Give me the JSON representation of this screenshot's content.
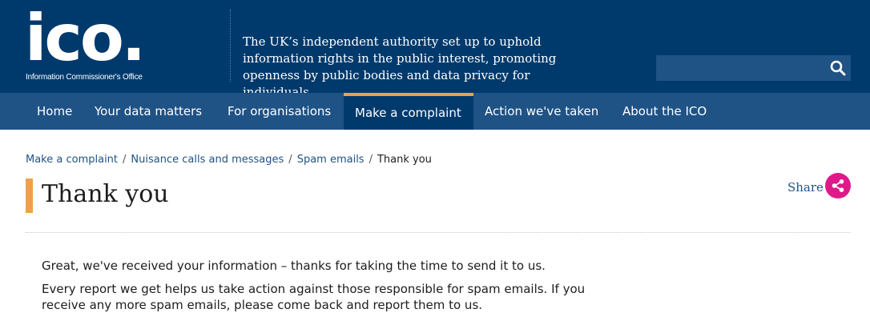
{
  "header": {
    "logo_text": "ico.",
    "logo_subtitle": "Information Commissioner's Office",
    "tagline": "The UK’s independent authority set up to uphold information rights in the public interest, promoting openness by public bodies and data privacy for individuals.",
    "search": {
      "value": "",
      "icon": "search-icon"
    }
  },
  "nav": {
    "items": [
      {
        "label": "Home",
        "active": false
      },
      {
        "label": "Your data matters",
        "active": false
      },
      {
        "label": "For organisations",
        "active": false
      },
      {
        "label": "Make a complaint",
        "active": true
      },
      {
        "label": "Action we've taken",
        "active": false
      },
      {
        "label": "About the ICO",
        "active": false
      }
    ]
  },
  "breadcrumb": {
    "items": [
      "Make a complaint",
      "Nuisance calls and messages",
      "Spam emails"
    ],
    "separator": "/",
    "current": "Thank you"
  },
  "page": {
    "title": "Thank you",
    "share_label": "Share",
    "paragraphs": [
      "Great, we've received your information – thanks for taking the time to send it to us.",
      "Every report we get helps us take action against those responsible for spam emails. If you receive any more spam emails, please come back and report them to us."
    ]
  },
  "colors": {
    "header_bg": "#003a6d",
    "nav_bg": "#1f5285",
    "accent_orange": "#f0a04b",
    "share_pink": "#e0198a",
    "link_blue": "#1f5285"
  }
}
